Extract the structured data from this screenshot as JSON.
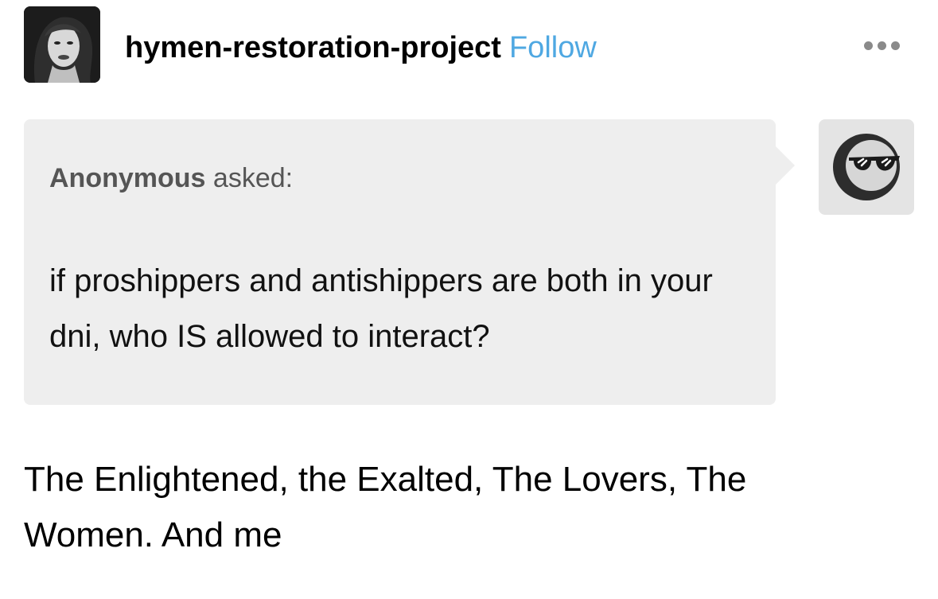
{
  "post": {
    "username": "hymen-restoration-project",
    "follow_label": "Follow",
    "avatar_icon": "profile-photo",
    "more_icon": "more-horizontal-icon"
  },
  "ask": {
    "asker": "Anonymous",
    "asked_label": "asked:",
    "question": "if proshippers and antishippers are both in your dni, who IS allowed to interact?",
    "asker_avatar_icon": "anonymous-sunglasses-icon"
  },
  "answer": {
    "text": "The Enlightened, the Exalted, The Lovers, The Women. And me"
  },
  "colors": {
    "follow": "#4fa8e2",
    "ask_background": "#eeeeee",
    "anon_avatar_background": "#e4e4e4",
    "asker_text": "#555555"
  }
}
